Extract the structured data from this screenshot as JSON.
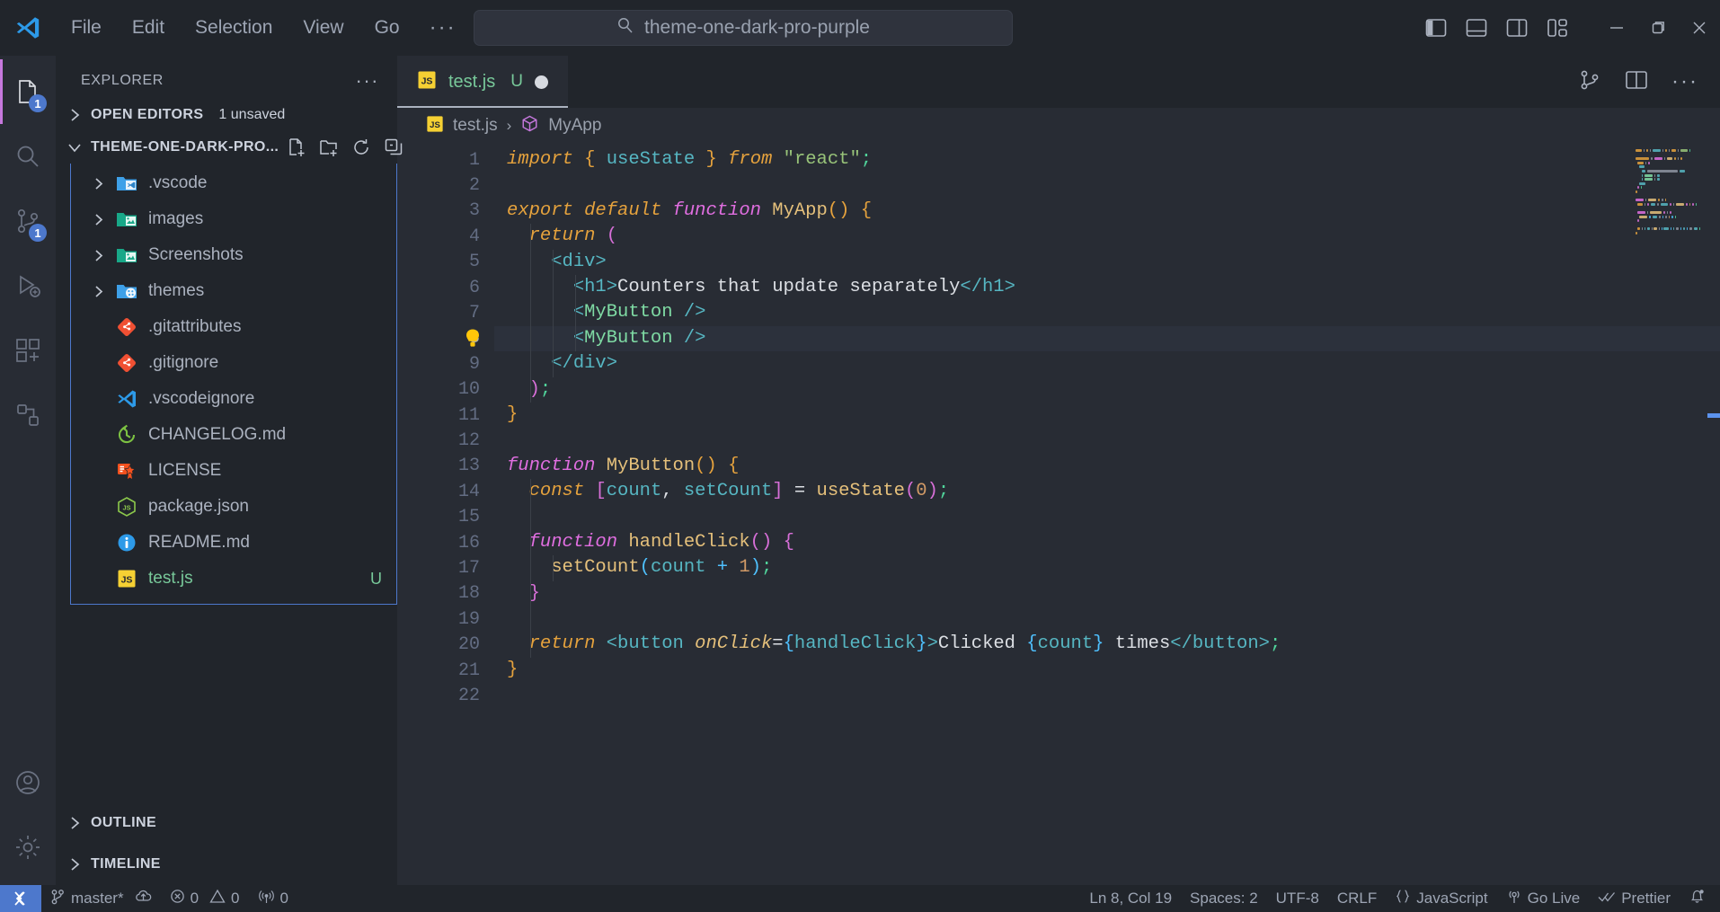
{
  "titlebar": {
    "logo_icon": "vscode-logo-icon",
    "menu": [
      "File",
      "Edit",
      "Selection",
      "View",
      "Go"
    ],
    "menu_overflow": "···",
    "back_icon": "arrow-left-icon",
    "forward_icon": "arrow-right-icon",
    "quick_input": {
      "search_icon": "search-icon",
      "value": "theme-one-dark-pro-purple"
    },
    "layout_icons": [
      "toggle-primary-sidebar-icon",
      "toggle-panel-icon",
      "toggle-secondary-sidebar-icon",
      "customize-layout-icon"
    ],
    "window_controls": [
      "minimize-icon",
      "maximize-icon",
      "close-icon"
    ]
  },
  "activitybar": {
    "items": [
      {
        "name": "explorer",
        "icon": "files-icon",
        "badge": "1",
        "active": true
      },
      {
        "name": "search",
        "icon": "search-icon",
        "badge": "",
        "active": false
      },
      {
        "name": "source-control",
        "icon": "source-control-icon",
        "badge": "1",
        "active": false
      },
      {
        "name": "run-and-debug",
        "icon": "debug-icon",
        "badge": "",
        "active": false
      },
      {
        "name": "extensions",
        "icon": "extensions-icon",
        "badge": "",
        "active": false
      },
      {
        "name": "remote-explorer",
        "icon": "remote-explorer-icon",
        "badge": "",
        "active": false
      }
    ],
    "bottom": [
      {
        "name": "accounts",
        "icon": "account-icon"
      },
      {
        "name": "manage",
        "icon": "gear-icon"
      }
    ]
  },
  "sidebar": {
    "title": "EXPLORER",
    "more_actions": "···",
    "sections": [
      {
        "label": "OPEN EDITORS",
        "sub": "1 unsaved",
        "expanded": false
      },
      {
        "label": "THEME-ONE-DARK-PRO...",
        "sub": "",
        "expanded": true
      }
    ],
    "folder_actions": [
      "new-file-icon",
      "new-folder-icon",
      "refresh-icon",
      "collapse-all-icon"
    ],
    "tree": [
      {
        "name": ".vscode",
        "type": "folder",
        "icon": "folder-vscode-icon",
        "badge": ""
      },
      {
        "name": "images",
        "type": "folder",
        "icon": "folder-images-icon",
        "badge": ""
      },
      {
        "name": "Screenshots",
        "type": "folder",
        "icon": "folder-images-icon",
        "badge": ""
      },
      {
        "name": "themes",
        "type": "folder",
        "icon": "folder-themes-icon",
        "badge": ""
      },
      {
        "name": ".gitattributes",
        "type": "file",
        "icon": "git-icon",
        "badge": ""
      },
      {
        "name": ".gitignore",
        "type": "file",
        "icon": "git-icon",
        "badge": ""
      },
      {
        "name": ".vscodeignore",
        "type": "file",
        "icon": "vscode-icon",
        "badge": ""
      },
      {
        "name": "CHANGELOG.md",
        "type": "file",
        "icon": "changelog-icon",
        "badge": ""
      },
      {
        "name": "LICENSE",
        "type": "file",
        "icon": "license-icon",
        "badge": ""
      },
      {
        "name": "package.json",
        "type": "file",
        "icon": "nodejs-icon",
        "badge": ""
      },
      {
        "name": "README.md",
        "type": "file",
        "icon": "readme-info-icon",
        "badge": ""
      },
      {
        "name": "test.js",
        "type": "file",
        "icon": "js-icon",
        "badge": "U",
        "modified": true
      }
    ],
    "bottom_sections": [
      "OUTLINE",
      "TIMELINE"
    ]
  },
  "editor": {
    "tab": {
      "icon": "js-icon",
      "name": "test.js",
      "badge": "U",
      "dirty_dot": true
    },
    "tab_actions": [
      "split-editor-icon",
      "more-actions-icon",
      "source-control-graph-icon"
    ],
    "breadcrumb": {
      "file_icon": "js-icon",
      "file": "test.js",
      "separator": "›",
      "symbol_icon": "symbol-class-icon",
      "symbol": "MyApp"
    },
    "lightbulb_line": 8,
    "active_line": 8,
    "lines": [
      {
        "n": 1,
        "tokens": [
          [
            "k",
            "import"
          ],
          [
            "txt",
            " "
          ],
          [
            "p1",
            "{"
          ],
          [
            "txt",
            " "
          ],
          [
            "var",
            "useState"
          ],
          [
            "txt",
            " "
          ],
          [
            "p1",
            "}"
          ],
          [
            "txt",
            " "
          ],
          [
            "k",
            "from"
          ],
          [
            "txt",
            " "
          ],
          [
            "str",
            "\"react\""
          ],
          [
            "sem",
            ";"
          ]
        ]
      },
      {
        "n": 2,
        "tokens": []
      },
      {
        "n": 3,
        "tokens": [
          [
            "k",
            "export default"
          ],
          [
            "txt",
            " "
          ],
          [
            "kf",
            "function"
          ],
          [
            "txt",
            " "
          ],
          [
            "fn",
            "MyApp"
          ],
          [
            "p1",
            "()"
          ],
          [
            "txt",
            " "
          ],
          [
            "p1",
            "{"
          ]
        ]
      },
      {
        "n": 4,
        "tokens": [
          [
            "txt",
            "  "
          ],
          [
            "k",
            "return"
          ],
          [
            "txt",
            " "
          ],
          [
            "p2",
            "("
          ]
        ]
      },
      {
        "n": 5,
        "tokens": [
          [
            "txt",
            "    "
          ],
          [
            "tag",
            "<div>"
          ]
        ]
      },
      {
        "n": 6,
        "tokens": [
          [
            "txt",
            "      "
          ],
          [
            "tag",
            "<h1>"
          ],
          [
            "txt",
            "Counters that update separately"
          ],
          [
            "tag",
            "</h1>"
          ]
        ]
      },
      {
        "n": 7,
        "tokens": [
          [
            "txt",
            "      "
          ],
          [
            "tag",
            "<"
          ],
          [
            "cmp",
            "MyButton"
          ],
          [
            "txt",
            " "
          ],
          [
            "tag",
            "/>"
          ]
        ]
      },
      {
        "n": 8,
        "tokens": [
          [
            "txt",
            "      "
          ],
          [
            "tag",
            "<"
          ],
          [
            "cmp",
            "MyButton"
          ],
          [
            "txt",
            " "
          ],
          [
            "tag",
            "/>"
          ]
        ]
      },
      {
        "n": 9,
        "tokens": [
          [
            "txt",
            "    "
          ],
          [
            "tag",
            "</div>"
          ]
        ]
      },
      {
        "n": 10,
        "tokens": [
          [
            "txt",
            "  "
          ],
          [
            "p2",
            ")"
          ],
          [
            "sem",
            ";"
          ]
        ]
      },
      {
        "n": 11,
        "tokens": [
          [
            "p1",
            "}"
          ]
        ]
      },
      {
        "n": 12,
        "tokens": []
      },
      {
        "n": 13,
        "tokens": [
          [
            "kf",
            "function"
          ],
          [
            "txt",
            " "
          ],
          [
            "fn",
            "MyButton"
          ],
          [
            "p1",
            "()"
          ],
          [
            "txt",
            " "
          ],
          [
            "p1",
            "{"
          ]
        ]
      },
      {
        "n": 14,
        "tokens": [
          [
            "txt",
            "  "
          ],
          [
            "k",
            "const"
          ],
          [
            "txt",
            " "
          ],
          [
            "p2",
            "["
          ],
          [
            "var",
            "count"
          ],
          [
            "txt",
            ", "
          ],
          [
            "var",
            "setCount"
          ],
          [
            "p2",
            "]"
          ],
          [
            "txt",
            " = "
          ],
          [
            "fn",
            "useState"
          ],
          [
            "p2",
            "("
          ],
          [
            "num",
            "0"
          ],
          [
            "p2",
            ")"
          ],
          [
            "sem",
            ";"
          ]
        ]
      },
      {
        "n": 15,
        "tokens": []
      },
      {
        "n": 16,
        "tokens": [
          [
            "txt",
            "  "
          ],
          [
            "kf",
            "function"
          ],
          [
            "txt",
            " "
          ],
          [
            "fn",
            "handleClick"
          ],
          [
            "p2",
            "()"
          ],
          [
            "txt",
            " "
          ],
          [
            "p2",
            "{"
          ]
        ]
      },
      {
        "n": 17,
        "tokens": [
          [
            "txt",
            "    "
          ],
          [
            "fn",
            "setCount"
          ],
          [
            "p3",
            "("
          ],
          [
            "var",
            "count"
          ],
          [
            "txt",
            " "
          ],
          [
            "p3",
            "+"
          ],
          [
            "txt",
            " "
          ],
          [
            "num",
            "1"
          ],
          [
            "p3",
            ")"
          ],
          [
            "sem",
            ";"
          ]
        ]
      },
      {
        "n": 18,
        "tokens": [
          [
            "txt",
            "  "
          ],
          [
            "p2",
            "}"
          ]
        ]
      },
      {
        "n": 19,
        "tokens": []
      },
      {
        "n": 20,
        "tokens": [
          [
            "txt",
            "  "
          ],
          [
            "k",
            "return"
          ],
          [
            "txt",
            " "
          ],
          [
            "tag",
            "<"
          ],
          [
            "tag",
            "button"
          ],
          [
            "txt",
            " "
          ],
          [
            "attr",
            "onClick"
          ],
          [
            "txt",
            "="
          ],
          [
            "p3",
            "{"
          ],
          [
            "var",
            "handleClick"
          ],
          [
            "p3",
            "}"
          ],
          [
            "tag",
            ">"
          ],
          [
            "txt",
            "Clicked "
          ],
          [
            "p3",
            "{"
          ],
          [
            "var",
            "count"
          ],
          [
            "p3",
            "}"
          ],
          [
            "txt",
            " times"
          ],
          [
            "tag",
            "</button>"
          ],
          [
            "sem",
            ";"
          ]
        ]
      },
      {
        "n": 21,
        "tokens": [
          [
            "p1",
            "}"
          ]
        ]
      },
      {
        "n": 22,
        "tokens": []
      }
    ]
  },
  "statusbar": {
    "remote_icon": "remote-window-icon",
    "branch_icon": "source-control-icon",
    "branch": "master*",
    "sync_icon": "sync-cloud-icon",
    "error_icon": "error-icon",
    "errors": "0",
    "warning_icon": "warning-icon",
    "warnings": "0",
    "ports_icon": "ports-icon",
    "ports": "0",
    "cursor_position": "Ln 8, Col 19",
    "indentation": "Spaces: 2",
    "encoding": "UTF-8",
    "eol": "CRLF",
    "language_icon": "braces-icon",
    "language": "JavaScript",
    "golive_icon": "broadcast-icon",
    "golive": "Go Live",
    "prettier_icon": "check-check-icon",
    "prettier": "Prettier",
    "bell_icon": "bell-dot-icon"
  },
  "colors": {
    "accent": "#c678dd",
    "remote_blue": "#4d78cc",
    "editor_bg": "#282c34",
    "chrome_bg": "#21252b",
    "green": "#78c99a",
    "keyword_orange": "#e5a23d",
    "function_pink": "#e06ee0"
  }
}
